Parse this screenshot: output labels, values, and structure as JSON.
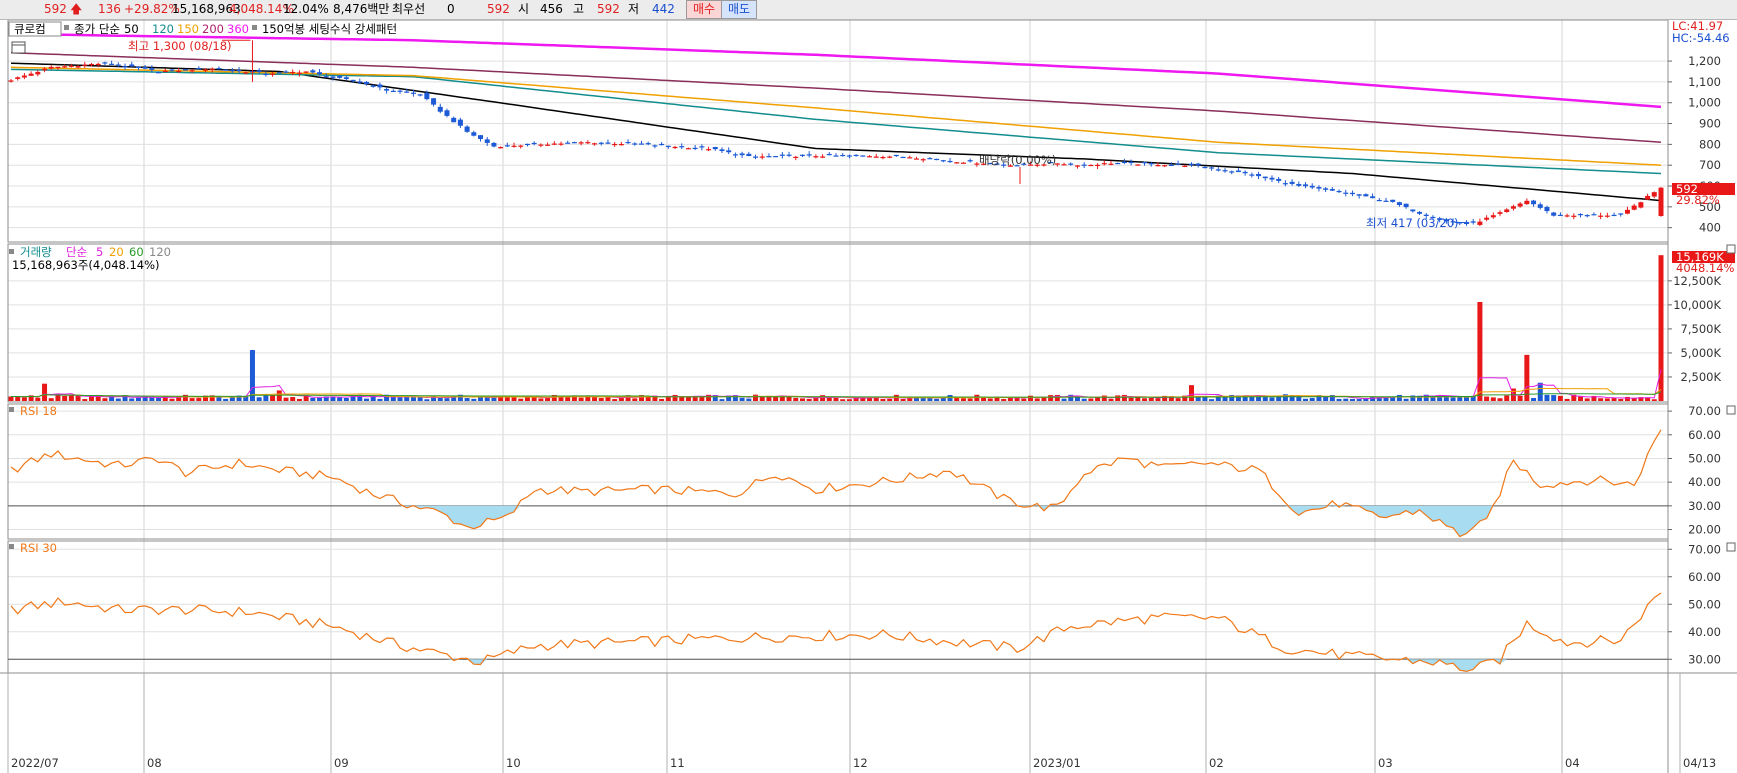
{
  "header": {
    "price": "592",
    "change": "136",
    "change_pct": "+29.82%",
    "volume": "15,168,963",
    "volume_pct": "4,048.14%",
    "turnover_pct": "12.04%",
    "amount": "8,476백만",
    "best_label": "최우선",
    "best_value": "0",
    "best_price": "592",
    "open_label": "시",
    "open_value": "456",
    "high_label": "고",
    "high_value": "592",
    "low_label": "저",
    "low_value": "442",
    "buy_label": "매수",
    "sell_label": "매도"
  },
  "price_panel": {
    "stock_name": "큐로컴",
    "ma_label": "종가 단순",
    "ma_periods": [
      "50",
      "120",
      "150",
      "200",
      "360"
    ],
    "pattern_label": "150억봉 세팅수식 강세패턴",
    "lc_label": "LC:41.97",
    "hc_label": "HC:-54.46",
    "high_annotation": "최고 1,300 (08/18)",
    "low_annotation": "최저 417 (03/20)",
    "dividend_annotation": "배당락(0.00%)",
    "last_price_tag": "592",
    "last_change_tag": "29.82%"
  },
  "volume_panel": {
    "title": "거래량",
    "ma_label": "단순",
    "ma_periods": [
      "5",
      "20",
      "60",
      "120"
    ],
    "volume_text": "15,168,963주(4,048.14%)",
    "last_tag": "15,169K",
    "last_pct_tag": "4048.14%"
  },
  "rsi1": {
    "title": "RSI 18"
  },
  "rsi2": {
    "title": "RSI 30"
  },
  "colors": {
    "up": "#e81818",
    "down": "#1c5ad6",
    "ma50": "#000000",
    "ma120": "#138d8d",
    "ma150": "#f0a000",
    "ma200": "#8a2e5a",
    "ma360": "#f018f0",
    "rsi": "#f07818",
    "rsi_fill": "#a8dcf0"
  },
  "chart_data": [
    {
      "type": "candlestick",
      "title": "큐로컴",
      "y_ticks": [
        400,
        500,
        600,
        700,
        800,
        900,
        1000,
        1100,
        1200
      ],
      "ylim": [
        360,
        1330
      ],
      "x_ticks": [
        "2022/07",
        "08",
        "09",
        "10",
        "11",
        "12",
        "2023/01",
        "02",
        "03",
        "04",
        "04/13"
      ],
      "max": {
        "value": 1300,
        "date": "08/18"
      },
      "min": {
        "value": 417,
        "date": "03/20"
      },
      "last": {
        "open": 456,
        "high": 592,
        "low": 442,
        "close": 592,
        "change_pct": 29.82
      },
      "close_path": [
        [
          0,
          1110
        ],
        [
          6,
          1170
        ],
        [
          14,
          1190
        ],
        [
          22,
          1150
        ],
        [
          30,
          1165
        ],
        [
          38,
          1140
        ],
        [
          44,
          1150
        ],
        [
          48,
          1120
        ],
        [
          52,
          1100
        ],
        [
          56,
          1060
        ],
        [
          61,
          1040
        ],
        [
          64,
          960
        ],
        [
          68,
          860
        ],
        [
          72,
          790
        ],
        [
          78,
          800
        ],
        [
          86,
          810
        ],
        [
          94,
          800
        ],
        [
          104,
          780
        ],
        [
          110,
          740
        ],
        [
          118,
          745
        ],
        [
          128,
          745
        ],
        [
          134,
          740
        ],
        [
          140,
          720
        ],
        [
          150,
          700
        ],
        [
          156,
          710
        ],
        [
          160,
          700
        ],
        [
          164,
          710
        ],
        [
          176,
          700
        ],
        [
          184,
          660
        ],
        [
          192,
          600
        ],
        [
          200,
          560
        ],
        [
          206,
          520
        ],
        [
          210,
          470
        ],
        [
          214,
          430
        ],
        [
          218,
          420
        ],
        [
          222,
          470
        ],
        [
          226,
          530
        ],
        [
          230,
          460
        ],
        [
          240,
          460
        ],
        [
          246,
          592
        ]
      ],
      "moving_averages": [
        {
          "name": "50",
          "path": [
            [
              0,
              1190
            ],
            [
              40,
              1150
            ],
            [
              75,
              990
            ],
            [
              120,
              780
            ],
            [
              160,
              730
            ],
            [
              200,
              660
            ],
            [
              246,
              530
            ]
          ]
        },
        {
          "name": "120",
          "path": [
            [
              0,
              1160
            ],
            [
              60,
              1125
            ],
            [
              120,
              920
            ],
            [
              180,
              760
            ],
            [
              246,
              660
            ]
          ]
        },
        {
          "name": "150",
          "path": [
            [
              0,
              1170
            ],
            [
              60,
              1130
            ],
            [
              120,
              975
            ],
            [
              180,
              810
            ],
            [
              246,
              700
            ]
          ]
        },
        {
          "name": "200",
          "path": [
            [
              0,
              1240
            ],
            [
              60,
              1170
            ],
            [
              120,
              1070
            ],
            [
              180,
              960
            ],
            [
              246,
              810
            ]
          ]
        },
        {
          "name": "360",
          "path": [
            [
              0,
              1330
            ],
            [
              60,
              1300
            ],
            [
              120,
              1230
            ],
            [
              180,
              1140
            ],
            [
              246,
              980
            ]
          ]
        }
      ]
    },
    {
      "type": "bar",
      "title": "거래량",
      "y_ticks": [
        2500,
        5000,
        7500,
        10000,
        12500
      ],
      "y_tick_labels": [
        "2,500K",
        "5,000K",
        "7,500K",
        "10,000K",
        "12,500K"
      ],
      "ylim": [
        0,
        15500
      ],
      "spikes": [
        [
          5,
          1800
        ],
        [
          36,
          5300
        ],
        [
          40,
          1100
        ],
        [
          176,
          1650
        ],
        [
          190,
          700
        ],
        [
          219,
          10300
        ],
        [
          224,
          1300
        ],
        [
          226,
          4800
        ],
        [
          228,
          1900
        ],
        [
          246,
          15169
        ]
      ],
      "base": 300
    },
    {
      "type": "line",
      "title": "RSI 18",
      "y_ticks": [
        20,
        30,
        40,
        50,
        60,
        70
      ],
      "ylim": [
        16,
        73
      ],
      "threshold": 30,
      "path": [
        [
          0,
          45
        ],
        [
          6,
          52
        ],
        [
          10,
          50
        ],
        [
          16,
          47
        ],
        [
          22,
          50
        ],
        [
          26,
          44
        ],
        [
          34,
          48
        ],
        [
          40,
          45
        ],
        [
          48,
          42
        ],
        [
          54,
          35
        ],
        [
          60,
          30
        ],
        [
          64,
          27
        ],
        [
          68,
          21
        ],
        [
          74,
          25
        ],
        [
          78,
          37
        ],
        [
          86,
          36
        ],
        [
          96,
          37
        ],
        [
          108,
          35
        ],
        [
          114,
          44
        ],
        [
          120,
          37
        ],
        [
          132,
          41
        ],
        [
          140,
          45
        ],
        [
          148,
          33
        ],
        [
          152,
          30
        ],
        [
          156,
          29
        ],
        [
          160,
          44
        ],
        [
          166,
          50
        ],
        [
          172,
          46
        ],
        [
          178,
          48
        ],
        [
          186,
          45
        ],
        [
          192,
          27
        ],
        [
          198,
          31
        ],
        [
          204,
          25
        ],
        [
          210,
          28
        ],
        [
          216,
          18
        ],
        [
          220,
          23
        ],
        [
          224,
          49
        ],
        [
          228,
          39
        ],
        [
          236,
          41
        ],
        [
          242,
          39
        ],
        [
          246,
          63
        ]
      ]
    },
    {
      "type": "line",
      "title": "RSI 30",
      "y_ticks": [
        30,
        40,
        50,
        60,
        70
      ],
      "ylim": [
        25,
        73
      ],
      "threshold": 30,
      "path": [
        [
          0,
          48
        ],
        [
          8,
          51
        ],
        [
          16,
          48
        ],
        [
          26,
          48
        ],
        [
          36,
          47
        ],
        [
          48,
          42
        ],
        [
          58,
          35
        ],
        [
          64,
          32
        ],
        [
          70,
          29
        ],
        [
          78,
          35
        ],
        [
          90,
          36
        ],
        [
          110,
          38
        ],
        [
          130,
          39
        ],
        [
          150,
          34
        ],
        [
          158,
          42
        ],
        [
          170,
          45
        ],
        [
          180,
          45
        ],
        [
          190,
          34
        ],
        [
          200,
          31
        ],
        [
          206,
          30
        ],
        [
          212,
          29
        ],
        [
          218,
          26
        ],
        [
          222,
          30
        ],
        [
          226,
          43
        ],
        [
          232,
          36
        ],
        [
          240,
          37
        ],
        [
          246,
          55
        ]
      ]
    }
  ]
}
